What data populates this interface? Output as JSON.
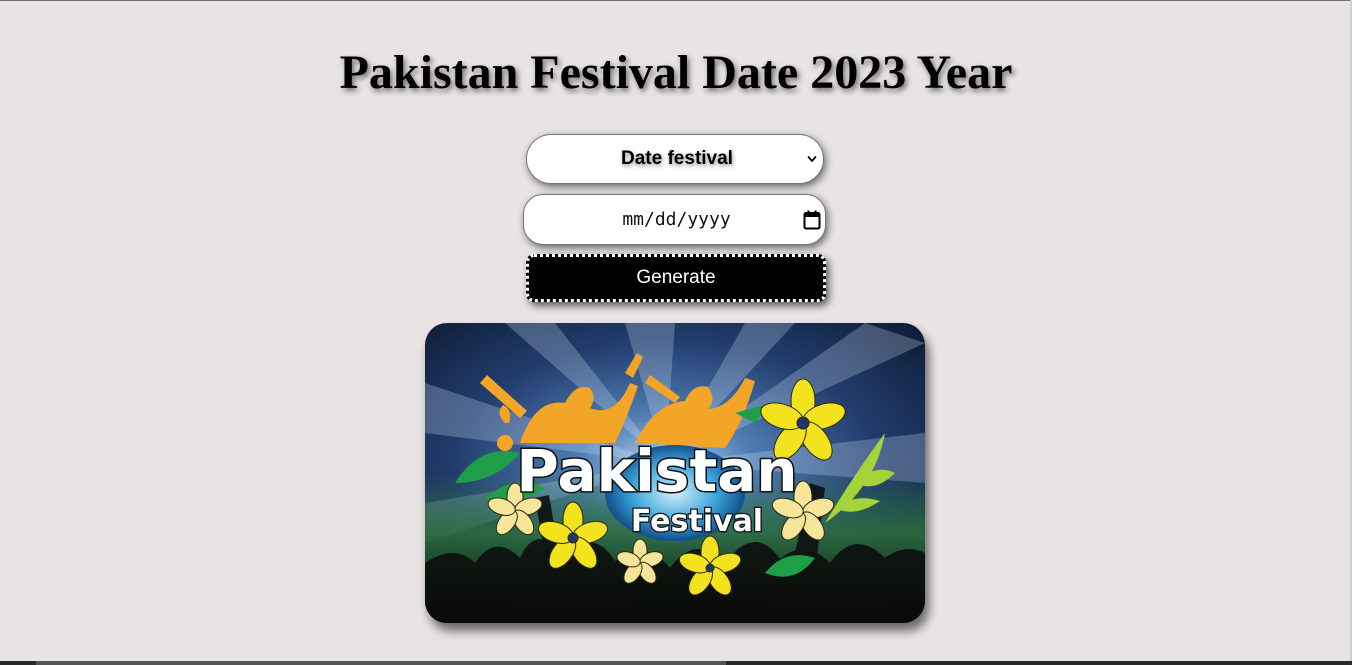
{
  "page": {
    "title": "Pakistan Festival Date 2023 Year"
  },
  "form": {
    "festival_select": {
      "selected": "Date festival",
      "icon": "chevron-down-icon"
    },
    "date_input": {
      "placeholder": "mm/dd/yyyy",
      "icon": "calendar-icon"
    },
    "generate_button": {
      "label": "Generate"
    }
  },
  "banner": {
    "logo_line1": "Pakistan",
    "logo_line2": "Festival"
  },
  "colors": {
    "background": "#e9e4e4",
    "button_bg": "#000000",
    "button_text": "#ffffff",
    "crowd_orange": "#f2a527",
    "flower_yellow": "#f3e21e",
    "leaf_green": "#1f9e48"
  }
}
